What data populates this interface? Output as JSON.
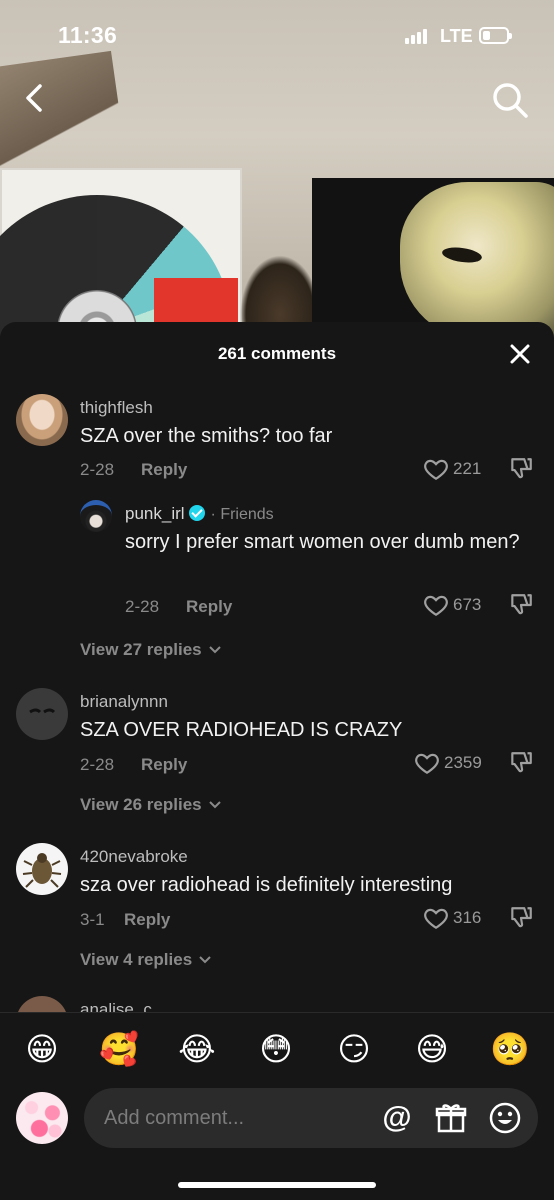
{
  "status_bar": {
    "time": "11:36",
    "network": "LTE",
    "battery_level": 0.3
  },
  "sheet": {
    "comment_count_label": "261 comments"
  },
  "comments": [
    {
      "username": "thighflesh",
      "text": "SZA over the smiths? too far",
      "date": "2-28",
      "reply_label": "Reply",
      "likes": "221",
      "reply": {
        "username": "punk_irl",
        "tag": "· Friends",
        "text": "sorry I prefer smart women over dumb men?",
        "date": "2-28",
        "reply_label": "Reply",
        "likes": "673"
      },
      "view_replies": "View 27 replies"
    },
    {
      "username": "brianalynnn",
      "text": "SZA OVER RADIOHEAD IS CRAZY",
      "date": "2-28",
      "reply_label": "Reply",
      "likes": "2359",
      "view_replies": "View 26 replies"
    },
    {
      "username": "420nevabroke",
      "text": "sza over radiohead is definitely interesting",
      "date": "3-1",
      "reply_label": "Reply",
      "likes": "316",
      "view_replies": "View 4 replies"
    },
    {
      "username": "analise_c"
    }
  ],
  "emojis": [
    "😁",
    "🥰",
    "😂",
    "😳",
    "😏",
    "😅",
    "🥺"
  ],
  "input": {
    "placeholder": "Add comment...",
    "at_symbol": "@"
  }
}
